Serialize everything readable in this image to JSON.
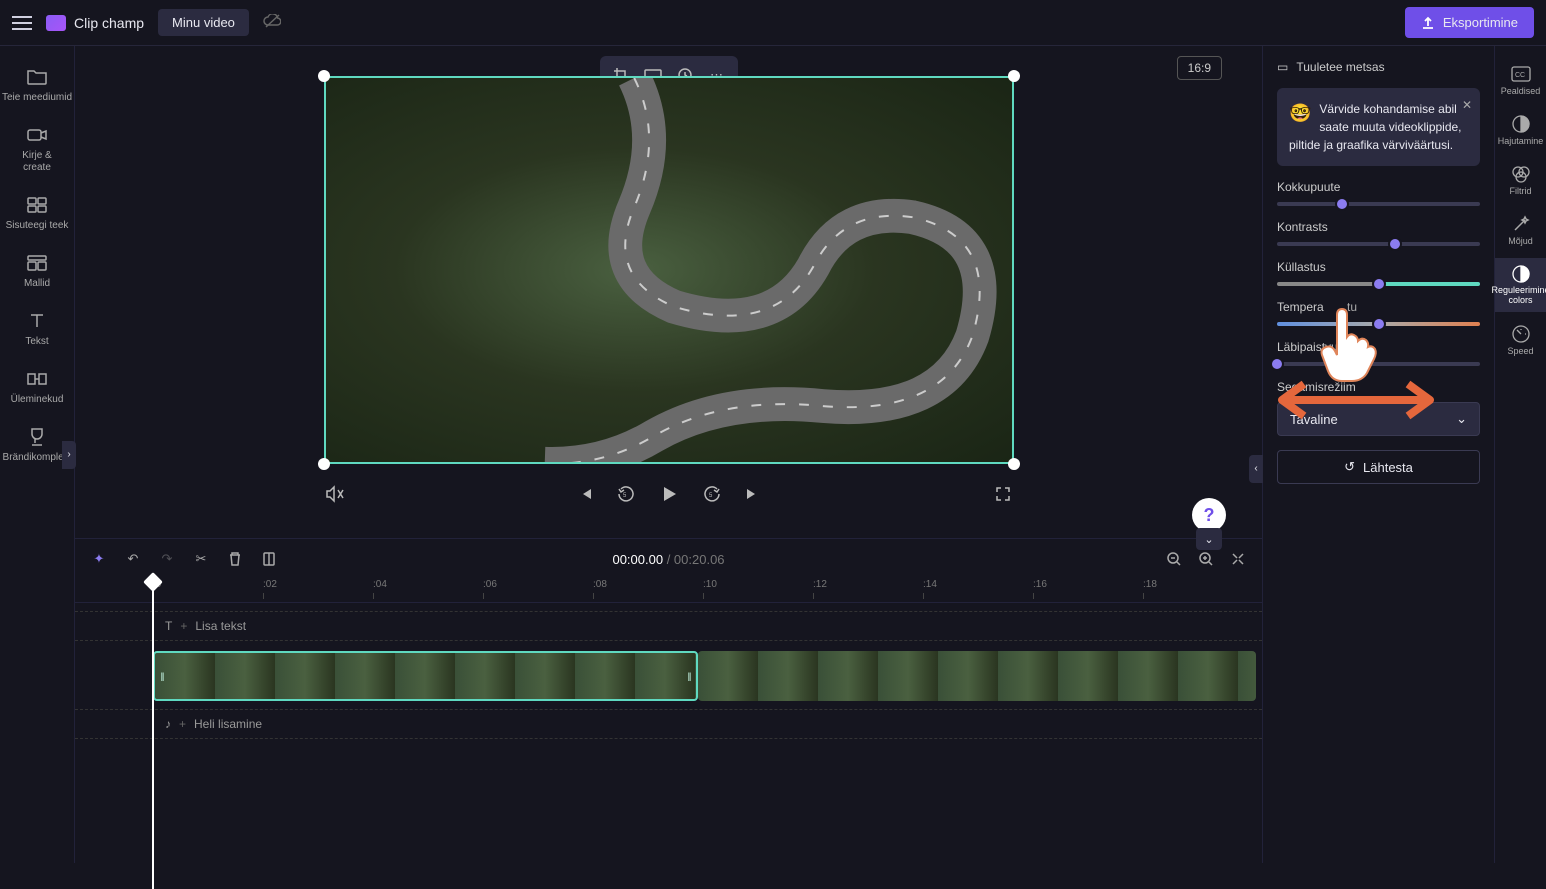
{
  "header": {
    "app_name": "Clip champ",
    "video_name": "Minu video",
    "export_label": "Eksportimine"
  },
  "left_rail": {
    "items": [
      {
        "label": "Teie meediumid"
      },
      {
        "label": "Kirje &amp; create"
      },
      {
        "label": "Sisuteegi teek"
      },
      {
        "label": "Mallid"
      },
      {
        "label": "Tekst"
      },
      {
        "label": "Üleminekud"
      },
      {
        "label": "Brändikomplekt"
      }
    ]
  },
  "preview": {
    "aspect_ratio": "16:9"
  },
  "timeline": {
    "current_time": "00:00.00",
    "duration": "00:20.06",
    "ticks": [
      ":0",
      ":02",
      ":04",
      ":06",
      ":08",
      ":10",
      ":12",
      ":14",
      ":16",
      ":18"
    ],
    "text_track_label": "Lisa tekst",
    "audio_track_label": "Heli lisamine"
  },
  "right_panel": {
    "clip_name": "Tuuletee metsas",
    "tip_text": "Värvide kohandamise abil saate muuta videoklippide, piltide ja graafika värviväärtusi.",
    "exposure_label": "Kokkupuute",
    "contrast_label": "Kontrasts",
    "saturation_label": "Küllastus",
    "temperature_label": "Tempera",
    "temperature_suffix": "tu",
    "transparency_label": "Läbipaistvus",
    "blend_mode_label": "Segamisrežiim",
    "blend_mode_value": "Tavaline",
    "reset_label": "Lähtesta"
  },
  "right_rail": {
    "items": [
      {
        "label": "Pealdised"
      },
      {
        "label": "Hajutamine"
      },
      {
        "label": "Filtrid"
      },
      {
        "label": "Mõjud"
      },
      {
        "label": "Reguleerimine colors",
        "active": true
      },
      {
        "label": "Speed"
      }
    ]
  }
}
